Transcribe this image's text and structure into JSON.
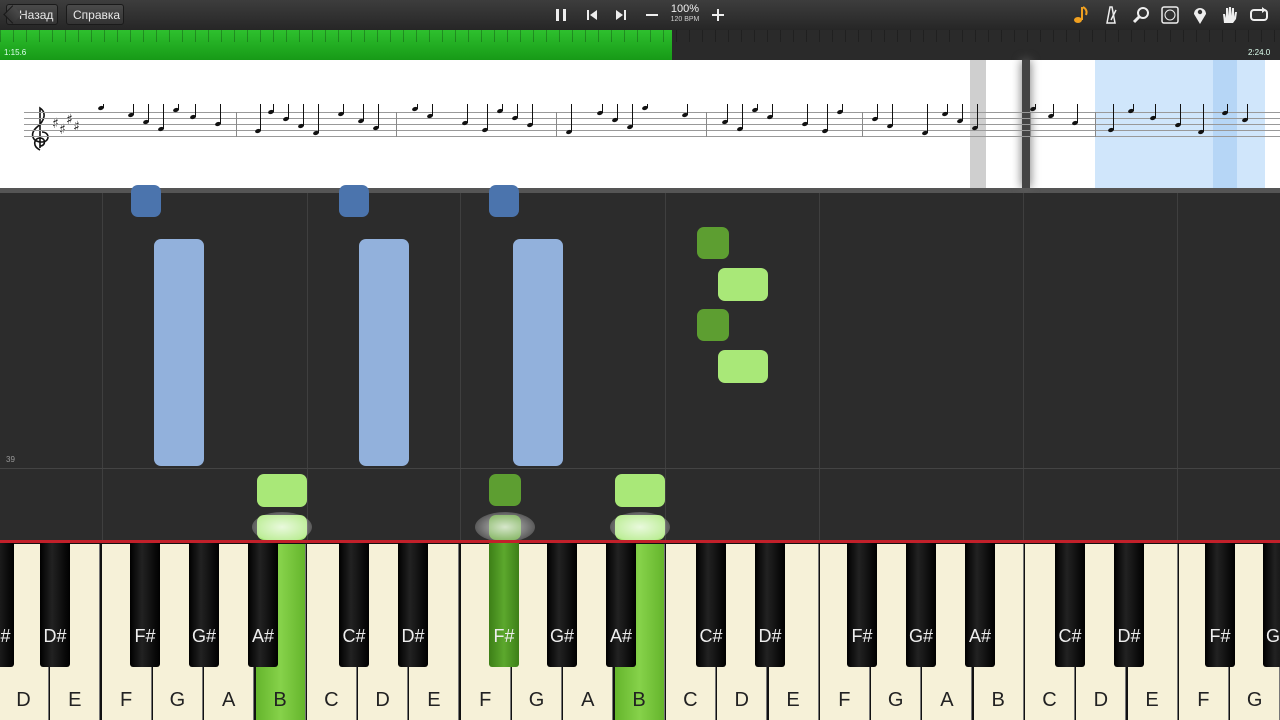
{
  "toolbar": {
    "back_label": "Назад",
    "help_label": "Справка",
    "zoom_pct": "100%",
    "bpm": "120 BPM"
  },
  "progress": {
    "elapsed": "1:15.6",
    "total": "2:24.0",
    "fraction": 0.525
  },
  "roll": {
    "measure": "39"
  },
  "keyboard": {
    "white_keys": [
      "D",
      "E",
      "F",
      "G",
      "A",
      "B",
      "C",
      "D",
      "E",
      "F",
      "G",
      "A",
      "B",
      "C",
      "D",
      "E",
      "F",
      "G",
      "A",
      "B",
      "C",
      "D",
      "E",
      "F",
      "G"
    ],
    "black_keys": [
      "C#",
      "D#",
      "F#",
      "G#",
      "A#",
      "C#",
      "D#",
      "F#",
      "G#",
      "A#",
      "C#",
      "D#",
      "F#",
      "G#",
      "A#",
      "C#",
      "D#",
      "F#",
      "G#"
    ],
    "active_white": [
      5,
      12
    ],
    "active_black": [
      7
    ]
  },
  "colors": {
    "left_hand": "#92b1dc",
    "right_hand": "#a9e878",
    "progress": "#1fae1f",
    "key_line": "#c2202a"
  },
  "icons": [
    "back-icon",
    "pause-icon",
    "skip-back-icon",
    "skip-forward-icon",
    "minus-icon",
    "plus-icon",
    "note-icon",
    "metronome-icon",
    "search-icon",
    "label-icon",
    "location-pin-icon",
    "hand-icon",
    "loop-icon"
  ]
}
